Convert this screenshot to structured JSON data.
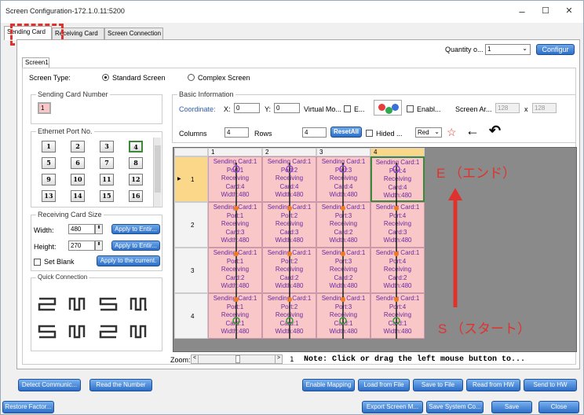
{
  "window": {
    "title": "Screen Configuration-172.1.0.11:5200",
    "minimize": "–",
    "maximize": "☐",
    "close": "✕"
  },
  "tabs": [
    {
      "label": "Sending Card"
    },
    {
      "label": "Receiving Card"
    },
    {
      "label": "Screen Connection"
    }
  ],
  "top": {
    "quantity_label": "Quantity o...",
    "quantity_value": "1",
    "configure_label": "Configur"
  },
  "subtab": "Screen1",
  "screen_type": {
    "label": "Screen Type:",
    "standard": "Standard Screen",
    "complex": "Complex Screen"
  },
  "sending_card_number": {
    "caption": "Sending Card Number",
    "value": "1"
  },
  "ethernet": {
    "caption": "Ethernet Port No.",
    "ports": [
      "1",
      "2",
      "3",
      "4",
      "5",
      "6",
      "7",
      "8",
      "9",
      "10",
      "11",
      "12",
      "13",
      "14",
      "15",
      "16"
    ]
  },
  "rcv_size": {
    "caption": "Receiving Card Size",
    "width_label": "Width:",
    "width_value": "480",
    "height_label": "Height:",
    "height_value": "270",
    "apply_entire_1": "Apply to Entir...",
    "apply_entire_2": "Apply to Entir...",
    "set_blank": "Set Blank",
    "apply_current": "Apply to the current."
  },
  "quick": {
    "caption": "Quick Connection"
  },
  "basic": {
    "caption": "Basic Information",
    "coordinate_label": "Coordinate:",
    "x_label": "X:",
    "x_value": "0",
    "y_label": "Y:",
    "y_value": "0",
    "virtual_label": "Virtual Mo...",
    "e_label": "E...",
    "enable_label": "Enabl...",
    "screen_area_label": "Screen Ar...",
    "sa_w": "128",
    "sa_x": "x",
    "sa_h": "128",
    "columns_label": "Columns",
    "columns_value": "4",
    "rows_label": "Rows",
    "rows_value": "4",
    "reset_all": "ResetAll",
    "hided_label": "Hided ...",
    "color_value": "Red",
    "back_arrow": "←",
    "undo_arrow": "↶"
  },
  "grid": {
    "col_headers": [
      "1",
      "2",
      "3",
      "4"
    ],
    "row_headers": [
      "1",
      "2",
      "3",
      "4"
    ],
    "cells": [
      [
        {
          "l1": "Sending Card:1",
          "l2": "Port:1",
          "l3": "Receiving",
          "l4": "Card:4",
          "l5": "Width:480"
        },
        {
          "l1": "Sending Card:1",
          "l2": "Port:2",
          "l3": "Receiving",
          "l4": "Card:4",
          "l5": "Width:480"
        },
        {
          "l1": "Sending Card:1",
          "l2": "Port:3",
          "l3": "Receiving",
          "l4": "Card:4",
          "l5": "Width:480"
        },
        {
          "l1": "Sending Card:1",
          "l2": "Port:4",
          "l3": "Receiving",
          "l4": "Card:4",
          "l5": "Width:480"
        }
      ],
      [
        {
          "l1": "Sending Card:1",
          "l2": "Port:1",
          "l3": "Receiving",
          "l4": "Card:3",
          "l5": "Width:480"
        },
        {
          "l1": "Sending Card:1",
          "l2": "Port:2",
          "l3": "Receiving",
          "l4": "Card:3",
          "l5": "Width:480"
        },
        {
          "l1": "Sending Card:1",
          "l2": "Port:3",
          "l3": "Receiving",
          "l4": "Card:2",
          "l5": "Width:480"
        },
        {
          "l1": "Sending Card:1",
          "l2": "Port:4",
          "l3": "Receiving",
          "l4": "Card:3",
          "l5": "Width:480"
        }
      ],
      [
        {
          "l1": "Sending Card:1",
          "l2": "Port:1",
          "l3": "Receiving",
          "l4": "Card:2",
          "l5": "Width:480"
        },
        {
          "l1": "Sending Card:1",
          "l2": "Port:2",
          "l3": "Receiving",
          "l4": "Card:2",
          "l5": "Width:480"
        },
        {
          "l1": "Sending Card:1",
          "l2": "Port:3",
          "l3": "Receiving",
          "l4": "Card:2",
          "l5": "Width:480"
        },
        {
          "l1": "Sending Card:1",
          "l2": "Port:4",
          "l3": "Receiving",
          "l4": "Card:2",
          "l5": "Width:480"
        }
      ],
      [
        {
          "l1": "Sending Card:1",
          "l2": "Port:1",
          "l3": "Receiving",
          "l4": "Card:1",
          "l5": "Width:480"
        },
        {
          "l1": "Sending Card:1",
          "l2": "Port:2",
          "l3": "Receiving",
          "l4": "Card:1",
          "l5": "Width:480"
        },
        {
          "l1": "Sending Card:1",
          "l2": "Port:3",
          "l3": "Receiving",
          "l4": "Card:1",
          "l5": "Width:480"
        },
        {
          "l1": "Sending Card:1",
          "l2": "Port:4",
          "l3": "Receiving",
          "l4": "Card:1",
          "l5": "Width:480"
        }
      ]
    ]
  },
  "annotations": {
    "end_label": "E （エンド）",
    "start_label": "S （スタート）",
    "accent_red": "#e0322d"
  },
  "zoom": {
    "label": "Zoom:",
    "value": "1",
    "note": "Note: Click or drag the left mouse button to..."
  },
  "buttons": {
    "detect": "Detect Communic...",
    "read_number": "Read the Number",
    "enable_mapping": "Enable Mapping",
    "load_file": "Load from File",
    "save_file": "Save to File",
    "read_hw": "Read from HW",
    "send_hw": "Send to HW",
    "restore": "Restore Factor...",
    "export": "Export Screen M...",
    "save_system": "Save System Co...",
    "save": "Save",
    "close": "Close"
  }
}
